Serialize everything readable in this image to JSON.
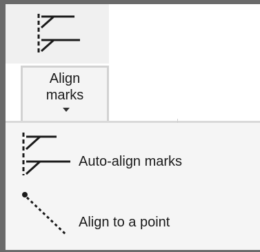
{
  "ribbon": {
    "align_marks": {
      "label": "Align\nmarks",
      "icon": "align-marks-icon"
    }
  },
  "menu": {
    "items": [
      {
        "label": "Auto-align marks",
        "icon": "auto-align-marks-icon"
      },
      {
        "label": "Align to a point",
        "icon": "align-to-point-icon"
      }
    ]
  }
}
